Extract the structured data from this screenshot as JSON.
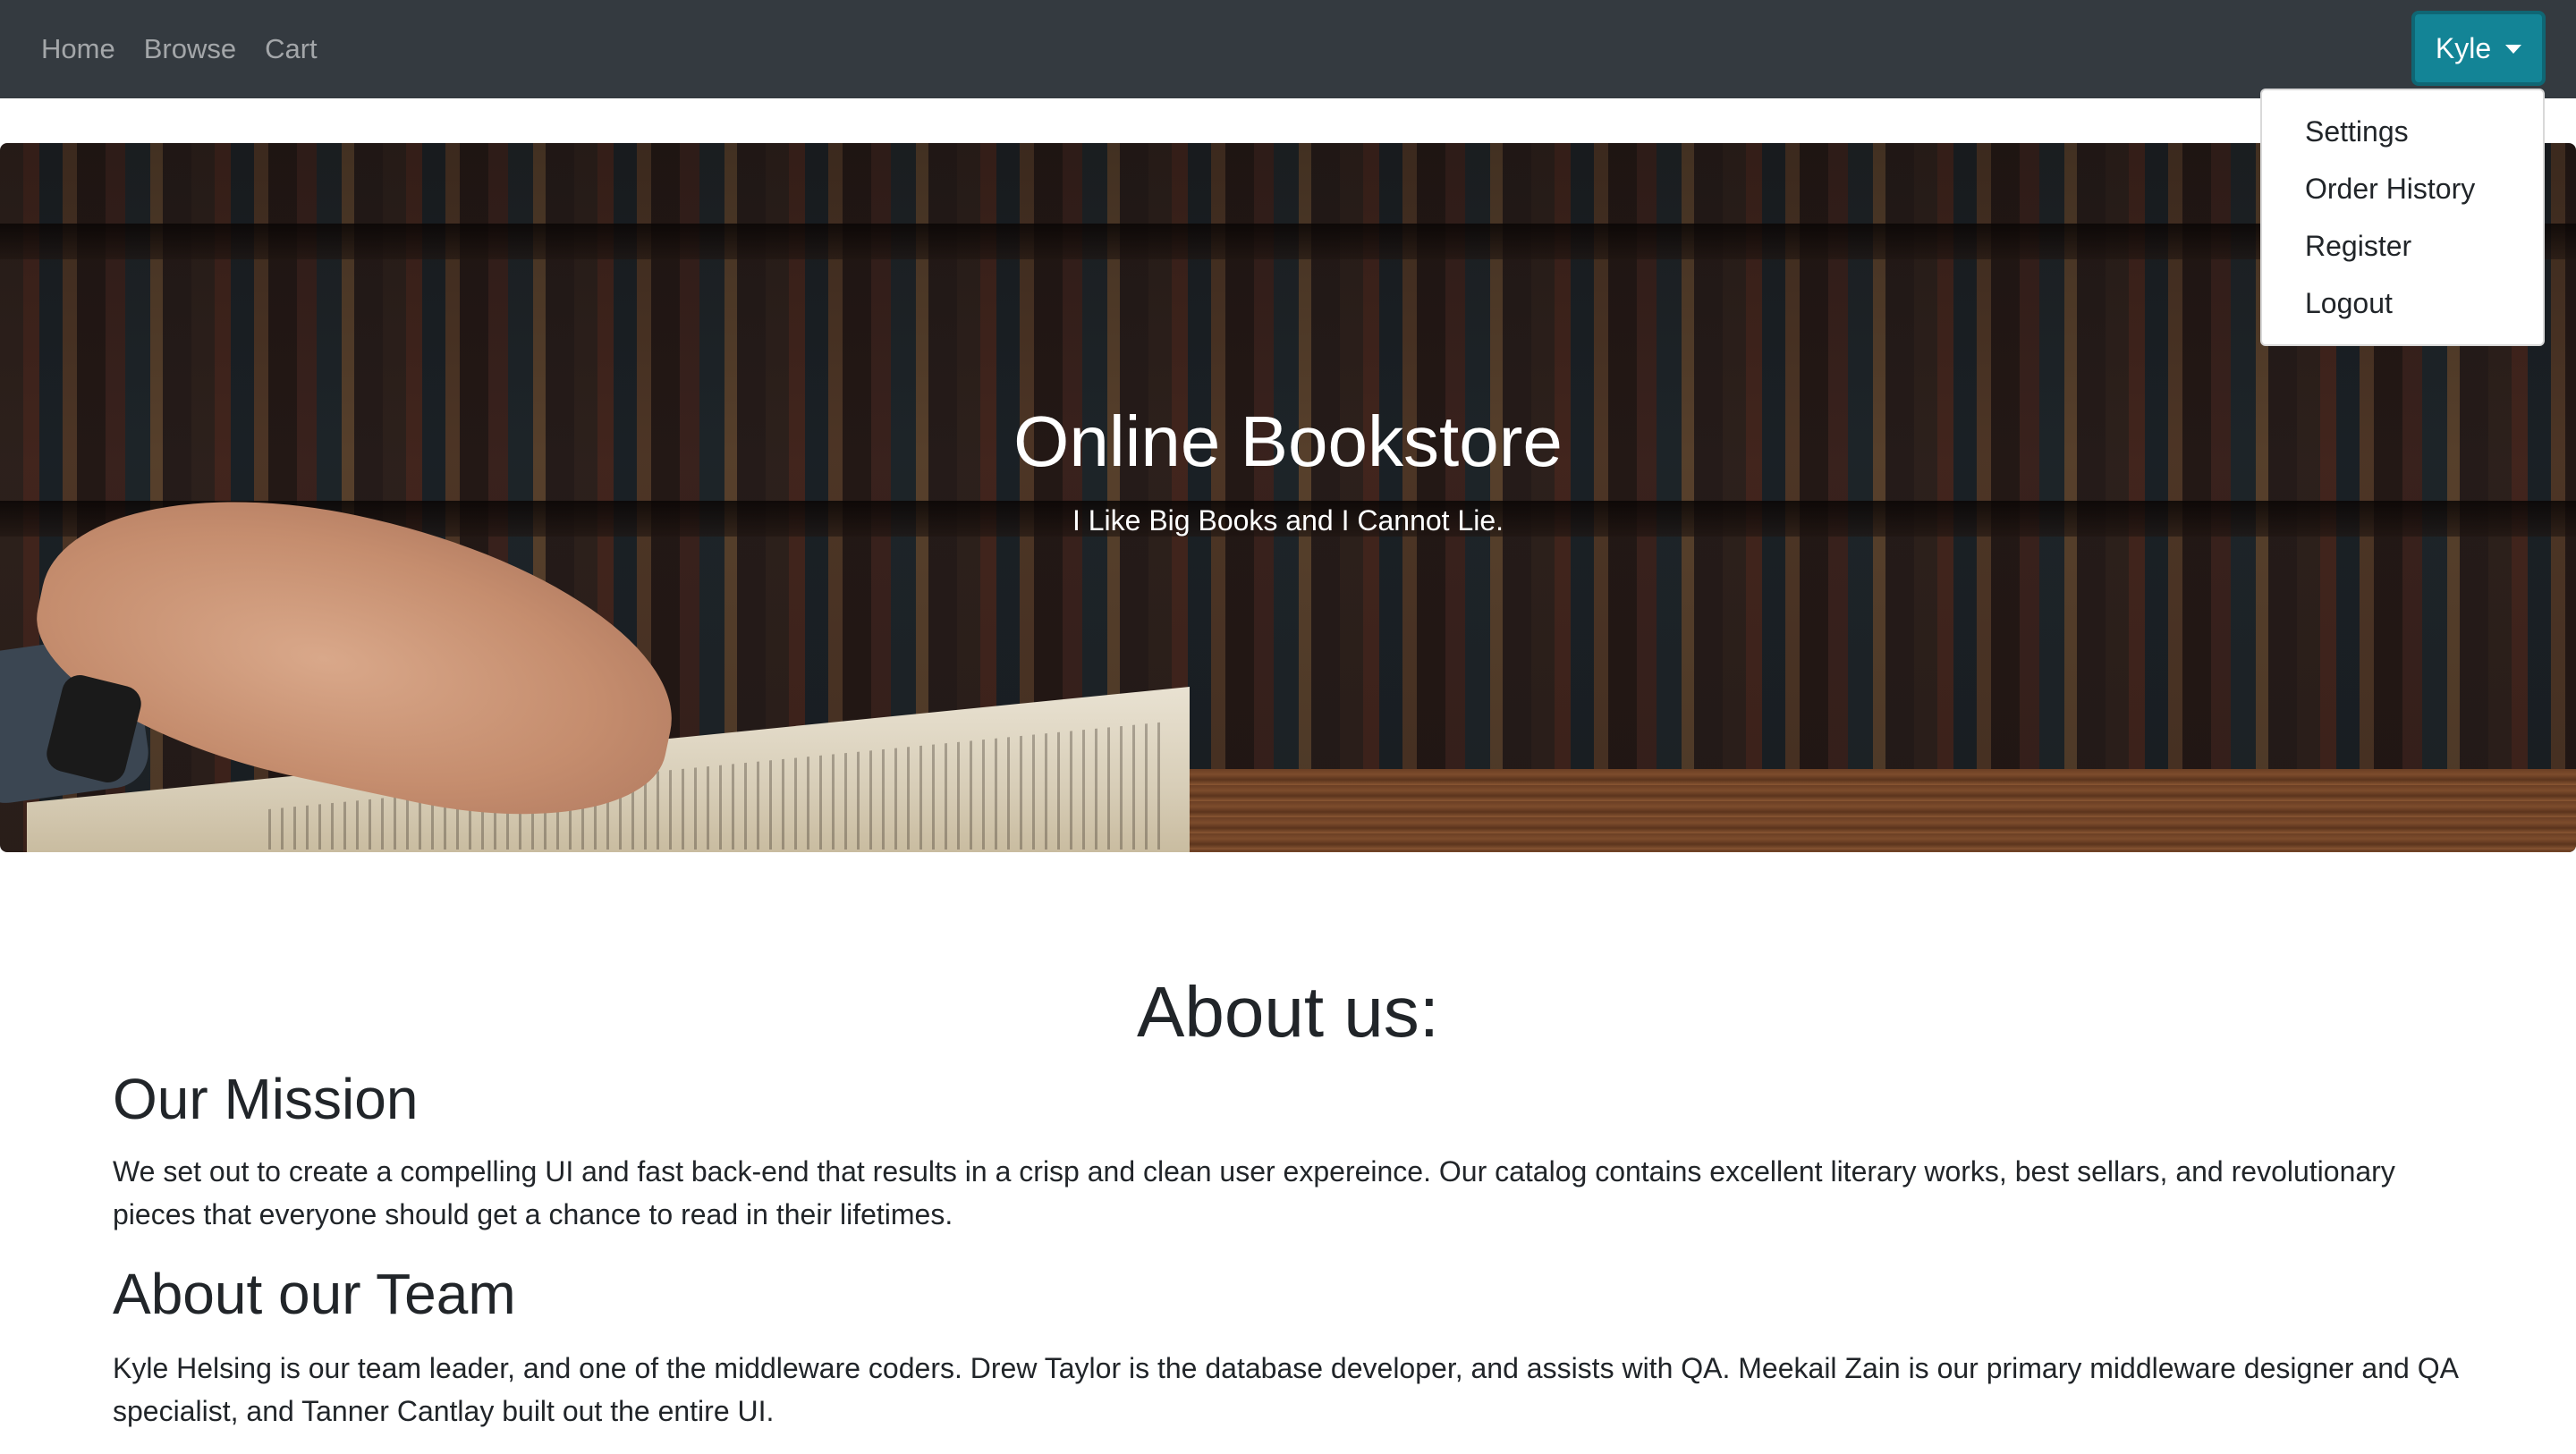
{
  "nav": {
    "links": [
      "Home",
      "Browse",
      "Cart"
    ]
  },
  "user_menu": {
    "username": "Kyle",
    "items": [
      "Settings",
      "Order History",
      "Register",
      "Logout"
    ],
    "button_color": "#138496"
  },
  "hero": {
    "title": "Online Bookstore",
    "subtitle": "I Like Big Books and I Cannot Lie."
  },
  "about": {
    "heading": "About us:",
    "mission_heading": "Our Mission",
    "mission_text": "We set out to create a compelling UI and fast back-end that results in a crisp and clean user expereince. Our catalog contains excellent literary works, best sellars, and revolutionary pieces that everyone should get a chance to read in their lifetimes.",
    "team_heading": "About our Team",
    "team_text": "Kyle Helsing is our team leader, and one of the middleware coders. Drew Taylor is the database developer, and assists with QA. Meekail Zain is our primary middleware designer and QA specialist, and Tanner Cantlay built out the entire UI."
  }
}
